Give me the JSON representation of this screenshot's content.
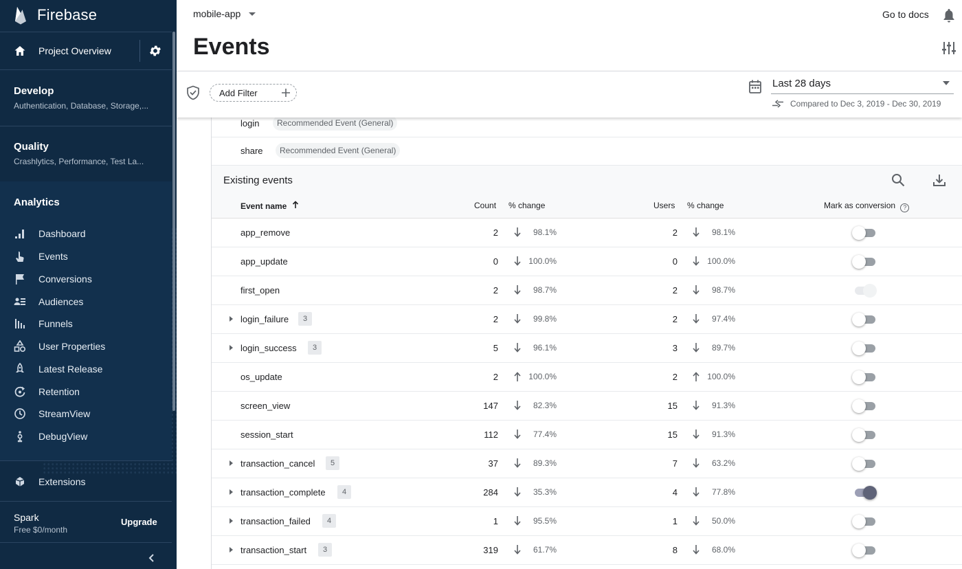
{
  "app": {
    "name": "Firebase"
  },
  "sidebar": {
    "project_overview": "Project Overview",
    "develop": {
      "title": "Develop",
      "subtitle": "Authentication, Database, Storage,..."
    },
    "quality": {
      "title": "Quality",
      "subtitle": "Crashlytics, Performance, Test La..."
    },
    "analytics": {
      "title": "Analytics",
      "items": [
        {
          "label": "Dashboard",
          "icon": "bar-chart-icon"
        },
        {
          "label": "Events",
          "icon": "touch-icon"
        },
        {
          "label": "Conversions",
          "icon": "flag-icon"
        },
        {
          "label": "Audiences",
          "icon": "people-list-icon"
        },
        {
          "label": "Funnels",
          "icon": "funnel-icon"
        },
        {
          "label": "User Properties",
          "icon": "shapes-icon"
        },
        {
          "label": "Latest Release",
          "icon": "rocket-icon"
        },
        {
          "label": "Retention",
          "icon": "retention-icon"
        },
        {
          "label": "StreamView",
          "icon": "clock-icon"
        },
        {
          "label": "DebugView",
          "icon": "debug-icon"
        }
      ]
    },
    "extensions": "Extensions",
    "plan": {
      "name": "Spark",
      "price": "Free $0/month",
      "upgrade": "Upgrade"
    }
  },
  "topbar": {
    "project": "mobile-app",
    "docs_link": "Go to docs"
  },
  "page": {
    "title": "Events"
  },
  "filter": {
    "add_filter": "Add Filter",
    "date_range": "Last 28 days",
    "compared": "Compared to Dec 3, 2019 - Dec 30, 2019"
  },
  "recommended": [
    {
      "name": "login",
      "tag": "Recommended Event (General)"
    },
    {
      "name": "share",
      "tag": "Recommended Event (General)"
    }
  ],
  "existing": {
    "title": "Existing events",
    "columns": {
      "event_name": "Event name",
      "count": "Count",
      "count_change": "% change",
      "users": "Users",
      "users_change": "% change",
      "mark_conversion": "Mark as conversion"
    },
    "rows": [
      {
        "name": "app_remove",
        "badge": "",
        "count": "2",
        "count_dir": "down",
        "count_pct": "98.1%",
        "users": "2",
        "users_dir": "down",
        "users_pct": "98.1%",
        "conversion": "off"
      },
      {
        "name": "app_update",
        "badge": "",
        "count": "0",
        "count_dir": "down",
        "count_pct": "100.0%",
        "users": "0",
        "users_dir": "down",
        "users_pct": "100.0%",
        "conversion": "off"
      },
      {
        "name": "first_open",
        "badge": "",
        "count": "2",
        "count_dir": "down",
        "count_pct": "98.7%",
        "users": "2",
        "users_dir": "down",
        "users_pct": "98.7%",
        "conversion": "disabled"
      },
      {
        "name": "login_failure",
        "badge": "3",
        "count": "2",
        "count_dir": "down",
        "count_pct": "99.8%",
        "users": "2",
        "users_dir": "down",
        "users_pct": "97.4%",
        "conversion": "off"
      },
      {
        "name": "login_success",
        "badge": "3",
        "count": "5",
        "count_dir": "down",
        "count_pct": "96.1%",
        "users": "3",
        "users_dir": "down",
        "users_pct": "89.7%",
        "conversion": "off"
      },
      {
        "name": "os_update",
        "badge": "",
        "count": "2",
        "count_dir": "up",
        "count_pct": "100.0%",
        "users": "2",
        "users_dir": "up",
        "users_pct": "100.0%",
        "conversion": "off"
      },
      {
        "name": "screen_view",
        "badge": "",
        "count": "147",
        "count_dir": "down",
        "count_pct": "82.3%",
        "users": "15",
        "users_dir": "down",
        "users_pct": "91.3%",
        "conversion": "off"
      },
      {
        "name": "session_start",
        "badge": "",
        "count": "112",
        "count_dir": "down",
        "count_pct": "77.4%",
        "users": "15",
        "users_dir": "down",
        "users_pct": "91.3%",
        "conversion": "off"
      },
      {
        "name": "transaction_cancel",
        "badge": "5",
        "count": "37",
        "count_dir": "down",
        "count_pct": "89.3%",
        "users": "7",
        "users_dir": "down",
        "users_pct": "63.2%",
        "conversion": "off"
      },
      {
        "name": "transaction_complete",
        "badge": "4",
        "count": "284",
        "count_dir": "down",
        "count_pct": "35.3%",
        "users": "4",
        "users_dir": "down",
        "users_pct": "77.8%",
        "conversion": "on"
      },
      {
        "name": "transaction_failed",
        "badge": "4",
        "count": "1",
        "count_dir": "down",
        "count_pct": "95.5%",
        "users": "1",
        "users_dir": "down",
        "users_pct": "50.0%",
        "conversion": "off"
      },
      {
        "name": "transaction_start",
        "badge": "3",
        "count": "319",
        "count_dir": "down",
        "count_pct": "61.7%",
        "users": "8",
        "users_dir": "down",
        "users_pct": "68.0%",
        "conversion": "off"
      }
    ]
  },
  "colors": {
    "sidebar_bg": "#102a43",
    "accent": "#5f6378",
    "text": "#202124",
    "muted": "#5f6368"
  }
}
